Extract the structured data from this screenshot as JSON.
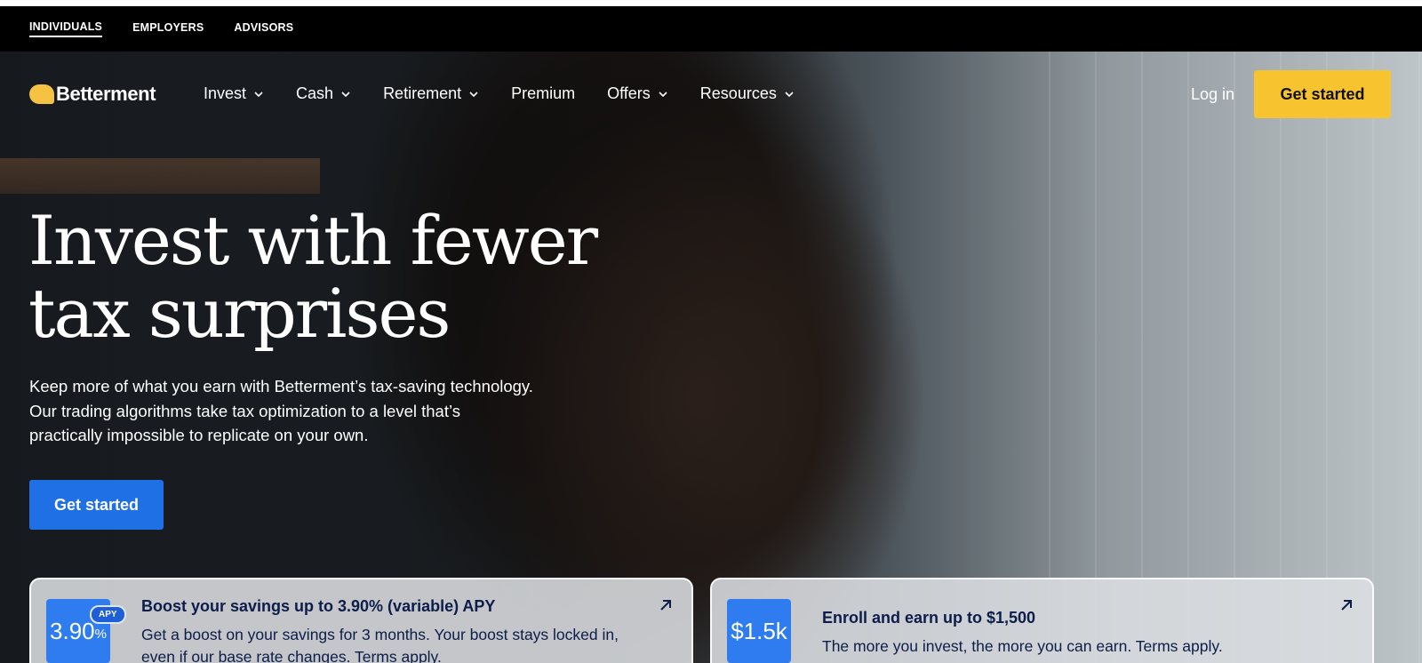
{
  "audience_tabs": [
    {
      "label": "INDIVIDUALS",
      "active": true
    },
    {
      "label": "EMPLOYERS",
      "active": false
    },
    {
      "label": "ADVISORS",
      "active": false
    }
  ],
  "brand": {
    "name": "Betterment",
    "logo_color": "#f5c242"
  },
  "nav": {
    "items": [
      {
        "label": "Invest",
        "has_dropdown": true
      },
      {
        "label": "Cash",
        "has_dropdown": true
      },
      {
        "label": "Retirement",
        "has_dropdown": true
      },
      {
        "label": "Premium",
        "has_dropdown": false
      },
      {
        "label": "Offers",
        "has_dropdown": true
      },
      {
        "label": "Resources",
        "has_dropdown": true
      }
    ],
    "login_label": "Log in",
    "cta_label": "Get started",
    "cta_color": "#f7c32f"
  },
  "hero": {
    "headline_line1": "Invest with fewer",
    "headline_line2": "tax surprises",
    "sub_line1": "Keep more of what you earn with Betterment’s tax-saving technology.",
    "sub_line2": "Our trading algorithms take tax optimization to a level that’s",
    "sub_line3": "practically impossible to replicate on your own.",
    "cta_label": "Get started",
    "cta_color": "#1f6fe5"
  },
  "cards": [
    {
      "badge_value": "3.90",
      "badge_suffix": "%",
      "badge_tag": "APY",
      "title": "Boost your savings up to 3.90% (variable) APY",
      "description": "Get a boost on your savings for 3 months. Your boost stays locked in, even if our base rate changes. Terms apply."
    },
    {
      "badge_value": "$1.5k",
      "title": "Enroll and earn up to $1,500",
      "description": "The more you invest, the more you can earn. Terms apply."
    }
  ]
}
